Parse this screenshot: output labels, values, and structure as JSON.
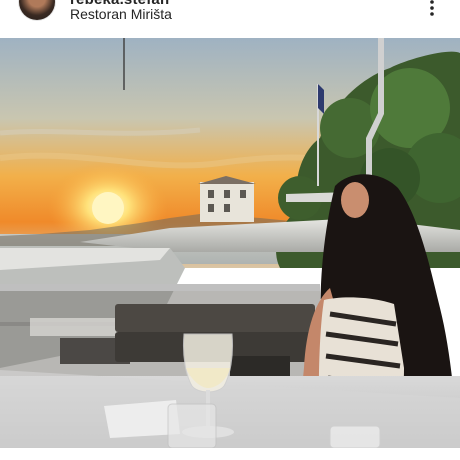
{
  "post": {
    "username": "rebeka.stefan",
    "location": "Restoran Mirišta",
    "more_icon": "more-vertical-icon",
    "photo_icon": "photo-sunset-restaurant"
  }
}
